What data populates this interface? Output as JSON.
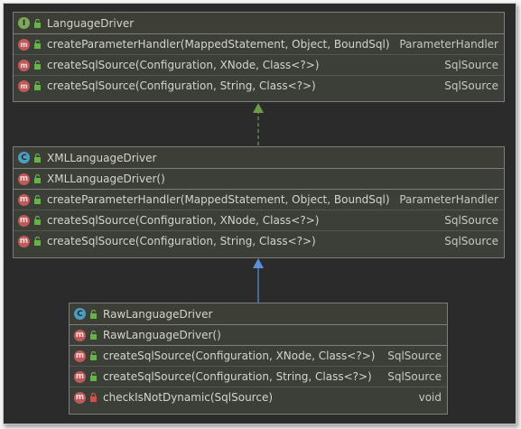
{
  "interface_box": {
    "title": "LanguageDriver",
    "icon": "interface-icon",
    "members": [
      {
        "name": "createParameterHandler(MappedStatement, Object, BoundSql)",
        "type": "ParameterHandler",
        "icon": "abstract-method-icon",
        "visibility": "public"
      },
      {
        "name": "createSqlSource(Configuration, XNode, Class<?>)",
        "type": "SqlSource",
        "icon": "abstract-method-icon",
        "visibility": "public"
      },
      {
        "name": "createSqlSource(Configuration, String, Class<?>)",
        "type": "SqlSource",
        "icon": "abstract-method-icon",
        "visibility": "public"
      }
    ]
  },
  "xml_box": {
    "title": "XMLLanguageDriver",
    "icon": "class-icon",
    "constructor": {
      "name": "XMLLanguageDriver()",
      "type": ""
    },
    "members": [
      {
        "name": "createParameterHandler(MappedStatement, Object, BoundSql)",
        "type": "ParameterHandler"
      },
      {
        "name": "createSqlSource(Configuration, XNode, Class<?>)",
        "type": "SqlSource"
      },
      {
        "name": "createSqlSource(Configuration, String, Class<?>)",
        "type": "SqlSource"
      }
    ]
  },
  "raw_box": {
    "title": "RawLanguageDriver",
    "icon": "class-icon",
    "constructor": {
      "name": "RawLanguageDriver()",
      "type": ""
    },
    "members": [
      {
        "name": "createSqlSource(Configuration, XNode, Class<?>)",
        "type": "SqlSource",
        "visibility": "public"
      },
      {
        "name": "createSqlSource(Configuration, String, Class<?>)",
        "type": "SqlSource",
        "visibility": "public"
      },
      {
        "name": "checkIsNotDynamic(SqlSource)",
        "type": "void",
        "visibility": "private"
      }
    ]
  },
  "colors": {
    "background": "#2b2b2b",
    "box": "#3c3f38",
    "implements_arrow": "#6a9a4a",
    "extends_arrow": "#5b8fd6"
  }
}
